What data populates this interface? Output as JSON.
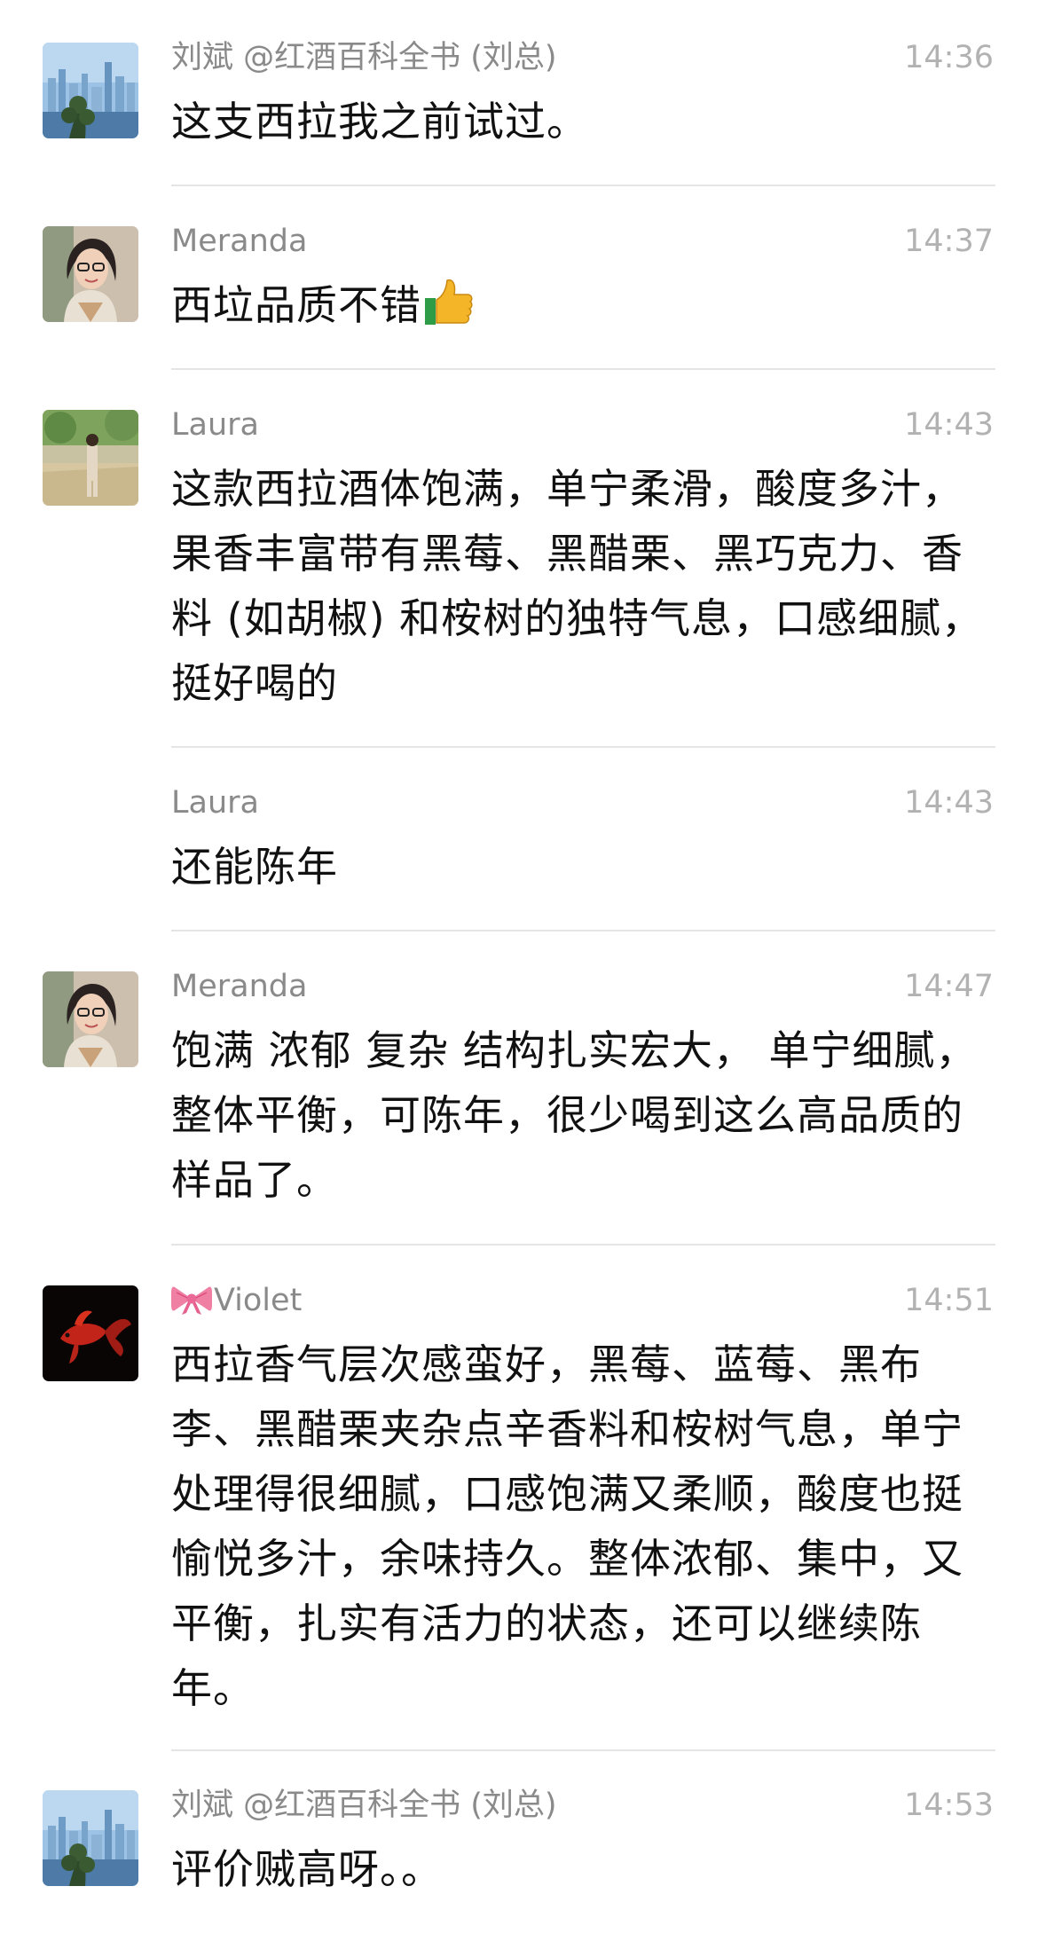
{
  "messages": [
    {
      "sender": "刘斌 @红酒百科全书 (刘总)",
      "time": "14:36",
      "text": "这支西拉我之前试过。"
    },
    {
      "sender": "Meranda",
      "time": "14:37",
      "text": "西垃品质不错"
    },
    {
      "sender": "Laura",
      "time": "14:43",
      "text": "这款西拉酒体饱满，单宁柔滑，酸度多汁，果香丰富带有黑莓、黑醋栗、黑巧克力、香料 (如胡椒) 和桉树的独特气息，口感细腻，挺好喝的"
    },
    {
      "sender": "Laura",
      "time": "14:43",
      "text": "还能陈年"
    },
    {
      "sender": "Meranda",
      "time": "14:47",
      "text": "饱满 浓郁 复杂 结构扎实宏大， 单宁细腻，整体平衡，可陈年，很少喝到这么高品质的样品了。"
    },
    {
      "sender": "Violet",
      "time": "14:51",
      "text": "西拉香气层次感蛮好，黑莓、蓝莓、黑布李、黑醋栗夹杂点辛香料和桉树气息，单宁处理得很细腻，口感饱满又柔顺，酸度也挺愉悦多汁，余味持久。整体浓郁、集中，又平衡，扎实有活力的状态，还可以继续陈年。"
    },
    {
      "sender": "刘斌 @红酒百科全书 (刘总)",
      "time": "14:53",
      "text": "评价贼高呀。。"
    }
  ],
  "icons": {
    "thumbs_up": "thumbs-up-icon",
    "bow": "bow-icon"
  },
  "colors": {
    "sender": "#8a8a8a",
    "time": "#b2b2b2",
    "text": "#111111",
    "divider": "#e5e5e5"
  }
}
